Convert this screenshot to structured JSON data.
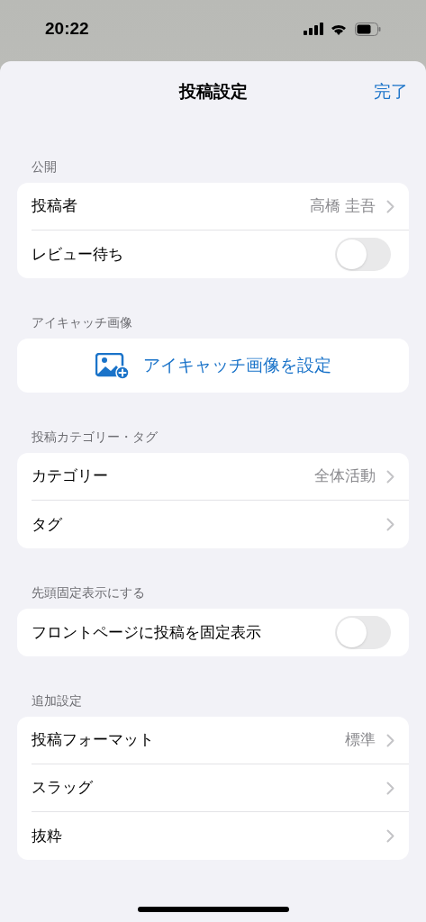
{
  "status_bar": {
    "time": "20:22"
  },
  "nav": {
    "title": "投稿設定",
    "done": "完了"
  },
  "sections": [
    {
      "header": "公開",
      "rows": [
        {
          "kind": "value",
          "label": "投稿者",
          "value": "高橋 圭吾"
        },
        {
          "kind": "toggle",
          "label": "レビュー待ち",
          "on": false
        }
      ]
    },
    {
      "header": "アイキャッチ画像",
      "rows": [
        {
          "kind": "action",
          "label": "アイキャッチ画像を設定"
        }
      ]
    },
    {
      "header": "投稿カテゴリー・タグ",
      "rows": [
        {
          "kind": "value",
          "label": "カテゴリー",
          "value": "全体活動"
        },
        {
          "kind": "value",
          "label": "タグ"
        }
      ]
    },
    {
      "header": "先頭固定表示にする",
      "rows": [
        {
          "kind": "toggle",
          "label": "フロントページに投稿を固定表示",
          "on": false
        }
      ]
    },
    {
      "header": "追加設定",
      "rows": [
        {
          "kind": "value",
          "label": "投稿フォーマット",
          "value": "標準"
        },
        {
          "kind": "value",
          "label": "スラッグ"
        },
        {
          "kind": "value",
          "label": "抜粋"
        }
      ]
    }
  ]
}
